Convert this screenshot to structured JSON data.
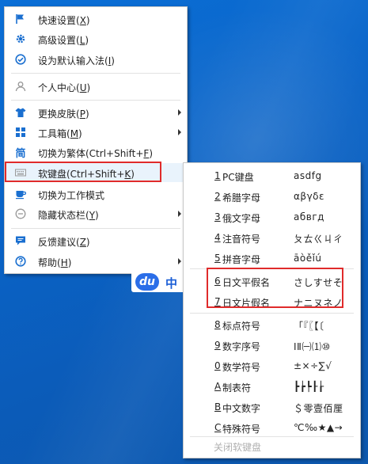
{
  "main_menu": {
    "items": [
      {
        "label": "快速设置(",
        "key": "X",
        "suffix": ")",
        "icon": "flag-icon"
      },
      {
        "label": "高级设置(",
        "key": "L",
        "suffix": ")",
        "icon": "gear-icon"
      },
      {
        "label": "设为默认输入法(",
        "key": "I",
        "suffix": ")",
        "icon": "check-circle-icon"
      },
      {
        "label": "个人中心(",
        "key": "U",
        "suffix": ")",
        "icon": "person-icon"
      },
      {
        "label": "更换皮肤(",
        "key": "P",
        "suffix": ")",
        "icon": "shirt-icon"
      },
      {
        "label": "工具箱(",
        "key": "M",
        "suffix": ")",
        "icon": "grid-icon"
      },
      {
        "label": "切换为繁体(Ctrl+Shift+",
        "key": "F",
        "suffix": ")",
        "icon": "trad-char-icon",
        "icon_text": "简"
      },
      {
        "label": "软键盘(Ctrl+Shift+",
        "key": "K",
        "suffix": ")",
        "icon": "keyboard-icon"
      },
      {
        "label": "切换为工作模式",
        "key": "",
        "suffix": "",
        "icon": "cup-icon"
      },
      {
        "label": "隐藏状态栏(",
        "key": "Y",
        "suffix": ")",
        "icon": "minus-circle-icon"
      },
      {
        "label": "反馈建议(",
        "key": "Z",
        "suffix": ")",
        "icon": "chat-icon"
      },
      {
        "label": "帮助(",
        "key": "H",
        "suffix": ")",
        "icon": "question-icon"
      }
    ]
  },
  "soft_keyboard_menu": {
    "items": [
      {
        "num": "1",
        "name": " PC键盘",
        "sample": "asdfg"
      },
      {
        "num": "2",
        "name": " 希腊字母",
        "sample": "αβγδε"
      },
      {
        "num": "3",
        "name": " 俄文字母",
        "sample": "абвгд"
      },
      {
        "num": "4",
        "name": " 注音符号",
        "sample": "ㄆㄊㄍㄐㄔ"
      },
      {
        "num": "5",
        "name": " 拼音字母",
        "sample": "āòěǐú"
      },
      {
        "num": "6",
        "name": " 日文平假名",
        "sample": "さしすせそ"
      },
      {
        "num": "7",
        "name": " 日文片假名",
        "sample": "ナニヌネノ"
      },
      {
        "num": "8",
        "name": " 标点符号",
        "sample": "「『〖【〔"
      },
      {
        "num": "9",
        "name": " 数字序号",
        "sample": "ⅠⅡ㈠⑴⑩"
      },
      {
        "num": "0",
        "name": " 数学符号",
        "sample": "±×÷∑√"
      },
      {
        "num": "A",
        "name": " 制表符",
        "sample": "┣┢┡┠┟"
      },
      {
        "num": "B",
        "name": " 中文数字",
        "sample": "＄零壹佰厘"
      },
      {
        "num": "C",
        "name": " 特殊符号",
        "sample": "℃‰★▲→"
      }
    ],
    "close_label": "关闭软键盘"
  },
  "ime_status": {
    "logo": "du",
    "mode": "中"
  },
  "colors": {
    "accent": "#1a6fd0",
    "highlight_box": "#e02b2b"
  }
}
